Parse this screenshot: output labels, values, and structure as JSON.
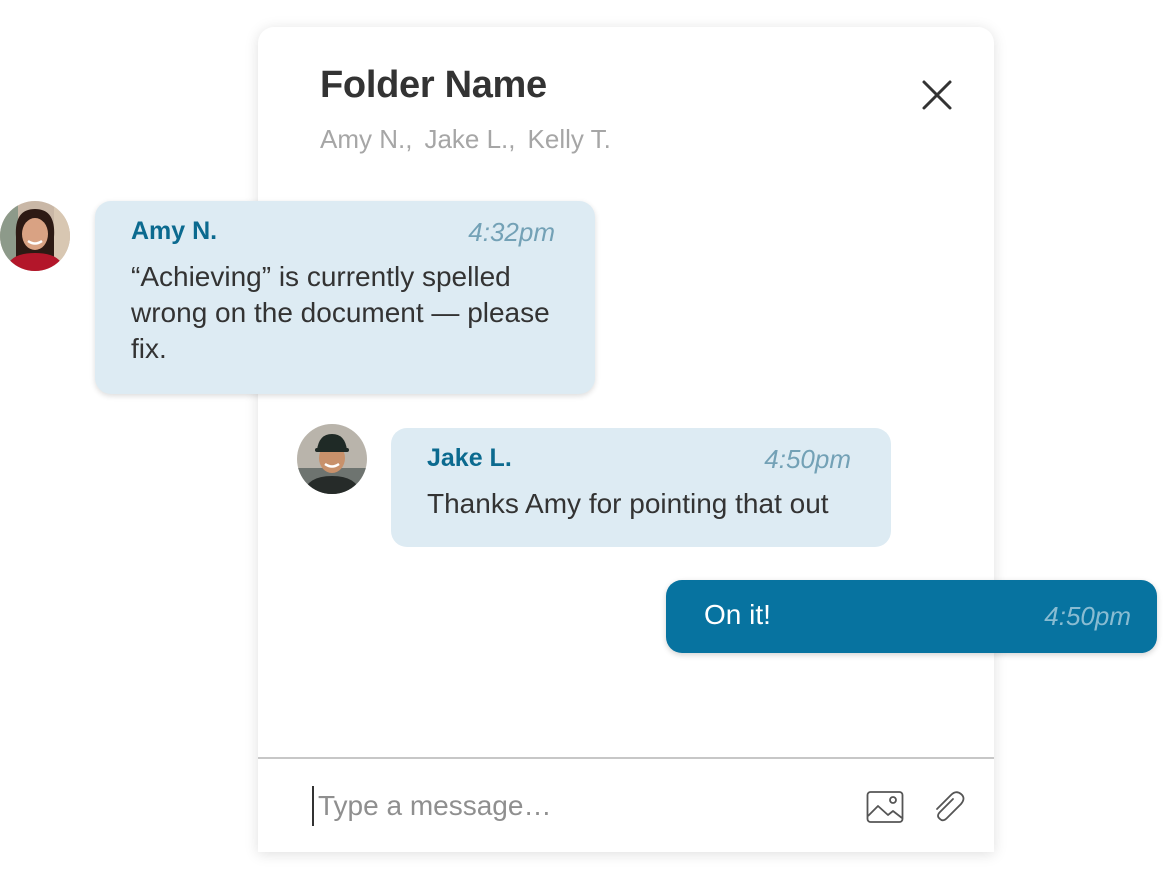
{
  "header": {
    "title": "Folder Name",
    "participants": [
      "Amy N.,",
      "Jake L.,",
      "Kelly T."
    ],
    "close_icon": "close-icon"
  },
  "messages": [
    {
      "sender": "Amy N.",
      "time": "4:32pm",
      "text": "“Achieving” is currently spelled wrong on the document — please fix.",
      "avatar": "avatar-amy"
    },
    {
      "sender": "Jake L.",
      "time": "4:50pm",
      "text": "Thanks Amy for pointing that out",
      "avatar": "avatar-jake"
    },
    {
      "time": "4:50pm",
      "text": "On it!",
      "outgoing": true
    }
  ],
  "composer": {
    "placeholder": "Type a message…",
    "icons": [
      "image-icon",
      "paperclip-icon"
    ]
  },
  "colors": {
    "incoming_bubble": "#ddebf3",
    "outgoing_bubble": "#0773a0",
    "sender_name": "#0b6a8f",
    "timestamp": "#73a1b6"
  }
}
